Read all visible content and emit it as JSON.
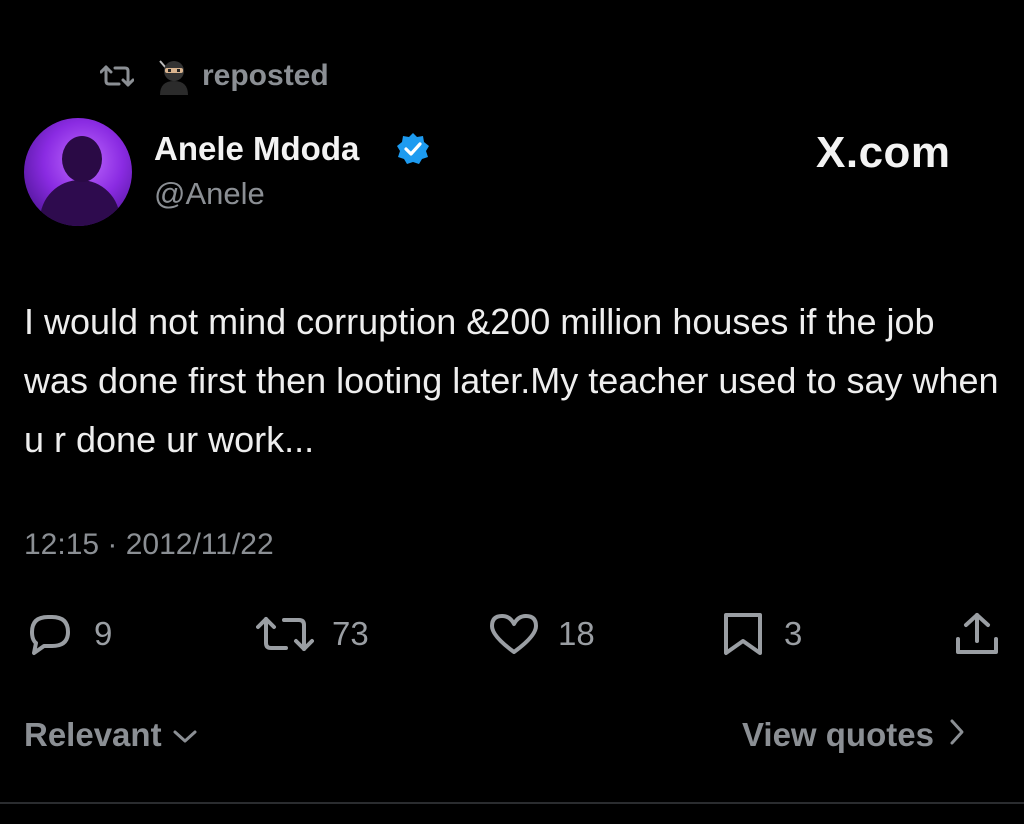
{
  "repost": {
    "label": "reposted",
    "emoji_icon": "ninja-icon"
  },
  "author": {
    "name": "Anele Mdoda",
    "handle": "@Anele",
    "verified": true,
    "verified_color": "#1d9bf0"
  },
  "brand": {
    "label": "X.com"
  },
  "tweet": {
    "text": "I would not mind corruption &200 million houses if the job was done first then looting later.My teacher used to say when u r done ur work...",
    "timestamp": "12:15 · 2012/11/22"
  },
  "stats": {
    "replies": "9",
    "reposts": "73",
    "likes": "18",
    "bookmarks": "3"
  },
  "footer": {
    "sort_label": "Relevant",
    "quotes_label": "View quotes"
  },
  "colors": {
    "background": "#000000",
    "muted": "#8b8f94",
    "text": "#e7e9ea"
  }
}
